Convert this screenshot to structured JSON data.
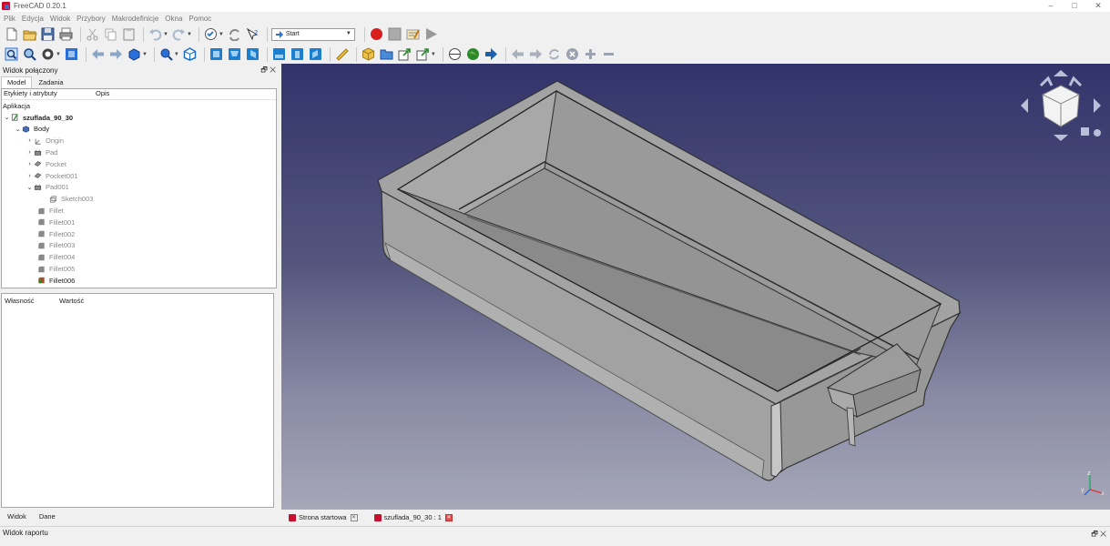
{
  "window": {
    "title": "FreeCAD 0.20.1",
    "controls": [
      "–",
      "□",
      "✕"
    ]
  },
  "menu": [
    "Plik",
    "Edycja",
    "Widok",
    "Przybory",
    "Makrodefinicje",
    "Okna",
    "Pomoc"
  ],
  "toolbar": {
    "workbench": "Start"
  },
  "combo_view": {
    "title": "Widok połączony",
    "title_controls": "🗗 ✕",
    "tabs": [
      "Model",
      "Zadania"
    ],
    "tree_headers": [
      "Etykiety i atrybuty",
      "Opis"
    ],
    "tree": [
      {
        "label": "Aplikacja",
        "style": "normal"
      },
      {
        "label": "szuflada_90_30",
        "style": "bold"
      },
      {
        "label": "Body",
        "style": "normal"
      },
      {
        "label": "Origin",
        "style": "grey"
      },
      {
        "label": "Pad",
        "style": "grey"
      },
      {
        "label": "Pocket",
        "style": "grey"
      },
      {
        "label": "Pocket001",
        "style": "grey"
      },
      {
        "label": "Pad001",
        "style": "grey"
      },
      {
        "label": "Sketch003",
        "style": "grey"
      },
      {
        "label": "Fillet",
        "style": "grey"
      },
      {
        "label": "Fillet001",
        "style": "grey"
      },
      {
        "label": "Fillet002",
        "style": "grey"
      },
      {
        "label": "Fillet003",
        "style": "grey"
      },
      {
        "label": "Fillet004",
        "style": "grey"
      },
      {
        "label": "Fillet005",
        "style": "grey"
      },
      {
        "label": "Fillet006",
        "style": "normal"
      }
    ],
    "props_headers": [
      "Własność",
      "Wartość"
    ],
    "bottom_tabs": [
      "Widok",
      "Dane"
    ]
  },
  "doc_tabs": [
    "Strona startowa",
    "szuflada_90_30 : 1"
  ],
  "report_view": {
    "title": "Widok raportu",
    "controls": "🗗 ✕"
  },
  "axis_labels": {
    "x": "x",
    "y": "y",
    "z": "z"
  },
  "colors": {
    "view_top": "#32336a",
    "view_bottom": "#a6a7b8",
    "model_face": "#9a9a9a",
    "record": "#d81e1e"
  }
}
